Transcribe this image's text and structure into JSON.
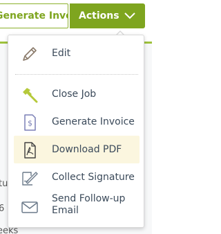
{
  "toolbar": {
    "generate_invoice_label": "Generate Invoice",
    "actions_label": "Actions",
    "accent_color": "#7ea51f"
  },
  "background": {
    "fragments": [
      "tu",
      "6",
      "eeks"
    ]
  },
  "menu": {
    "edit": {
      "label": "Edit",
      "icon": "pencil-icon"
    },
    "close_job": {
      "label": "Close Job",
      "icon": "hammer-icon"
    },
    "generate_invoice": {
      "label": "Generate Invoice",
      "icon": "invoice-dollar-icon"
    },
    "download_pdf": {
      "label": "Download PDF",
      "icon": "pdf-file-icon"
    },
    "collect_signature": {
      "label": "Collect Signature",
      "icon": "signature-pen-icon"
    },
    "send_follow_up": {
      "label_line1": "Send Follow-up",
      "label_line2": "Email",
      "icon": "envelope-icon"
    },
    "highlight_color": "#fbf6df"
  }
}
